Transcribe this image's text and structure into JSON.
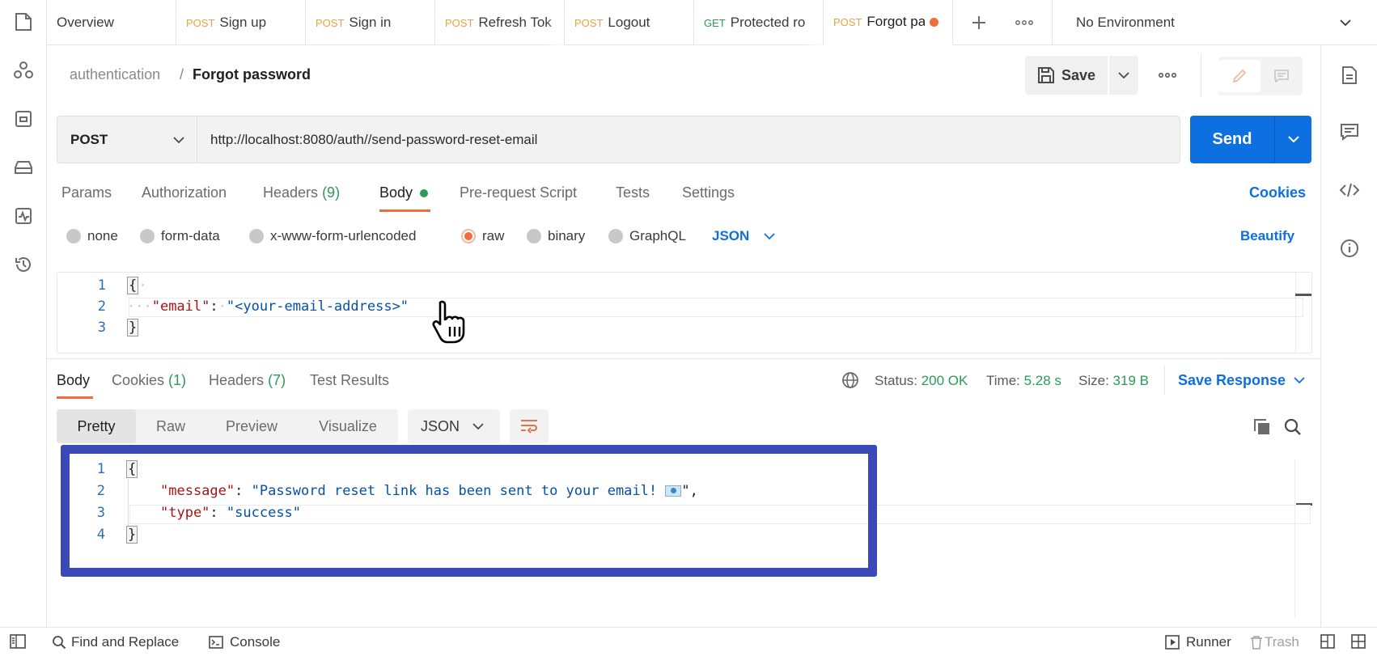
{
  "tabs": [
    {
      "label": "Overview",
      "method": ""
    },
    {
      "label": "Sign up",
      "method": "POST"
    },
    {
      "label": "Sign in",
      "method": "POST"
    },
    {
      "label": "Refresh Tok",
      "method": "POST"
    },
    {
      "label": "Logout",
      "method": "POST"
    },
    {
      "label": "Protected ro",
      "method": "GET"
    },
    {
      "label": "Forgot pa",
      "method": "POST"
    }
  ],
  "environment": "No Environment",
  "breadcrumb": {
    "collection": "authentication",
    "separator": "/",
    "request": "Forgot password"
  },
  "save_label": "Save",
  "request": {
    "method": "POST",
    "url": "http://localhost:8080/auth//send-password-reset-email",
    "send_label": "Send"
  },
  "request_tabs": {
    "params": "Params",
    "authorization": "Authorization",
    "headers": "Headers",
    "headers_count": "(9)",
    "body": "Body",
    "prerequest": "Pre-request Script",
    "tests": "Tests",
    "settings": "Settings",
    "cookies": "Cookies"
  },
  "body_types": {
    "none": "none",
    "form_data": "form-data",
    "urlencoded": "x-www-form-urlencoded",
    "raw": "raw",
    "binary": "binary",
    "graphql": "GraphQL",
    "format": "JSON",
    "beautify": "Beautify"
  },
  "request_body": {
    "lines": [
      "1",
      "2",
      "3"
    ],
    "open": "{",
    "key": "\"email\"",
    "colon": ":",
    "value": "\"<your-email-address>\"",
    "close": "}"
  },
  "response_tabs": {
    "body": "Body",
    "cookies": "Cookies",
    "cookies_count": "(1)",
    "headers": "Headers",
    "headers_count": "(7)",
    "test_results": "Test Results"
  },
  "response_meta": {
    "status_label": "Status:",
    "status_value": "200 OK",
    "time_label": "Time:",
    "time_value": "5.28 s",
    "size_label": "Size:",
    "size_value": "319 B",
    "save_response": "Save Response"
  },
  "view_modes": {
    "pretty": "Pretty",
    "raw": "Raw",
    "preview": "Preview",
    "visualize": "Visualize",
    "format": "JSON"
  },
  "response_body": {
    "lines": [
      "1",
      "2",
      "3",
      "4"
    ],
    "open": "{",
    "message_key": "\"message\"",
    "message_value": "\"Password reset link has been sent to your email! ",
    "message_end": "\",",
    "type_key": "\"type\"",
    "type_value": "\"success\"",
    "close": "}"
  },
  "status_bar": {
    "find_replace": "Find and Replace",
    "console": "Console",
    "runner": "Runner",
    "trash": "Trash"
  },
  "colors": {
    "accent_blue": "#0d6fe0",
    "status_green": "#2a9b57",
    "post_orange": "#e8a33d",
    "highlight_box": "#3b48b8"
  }
}
